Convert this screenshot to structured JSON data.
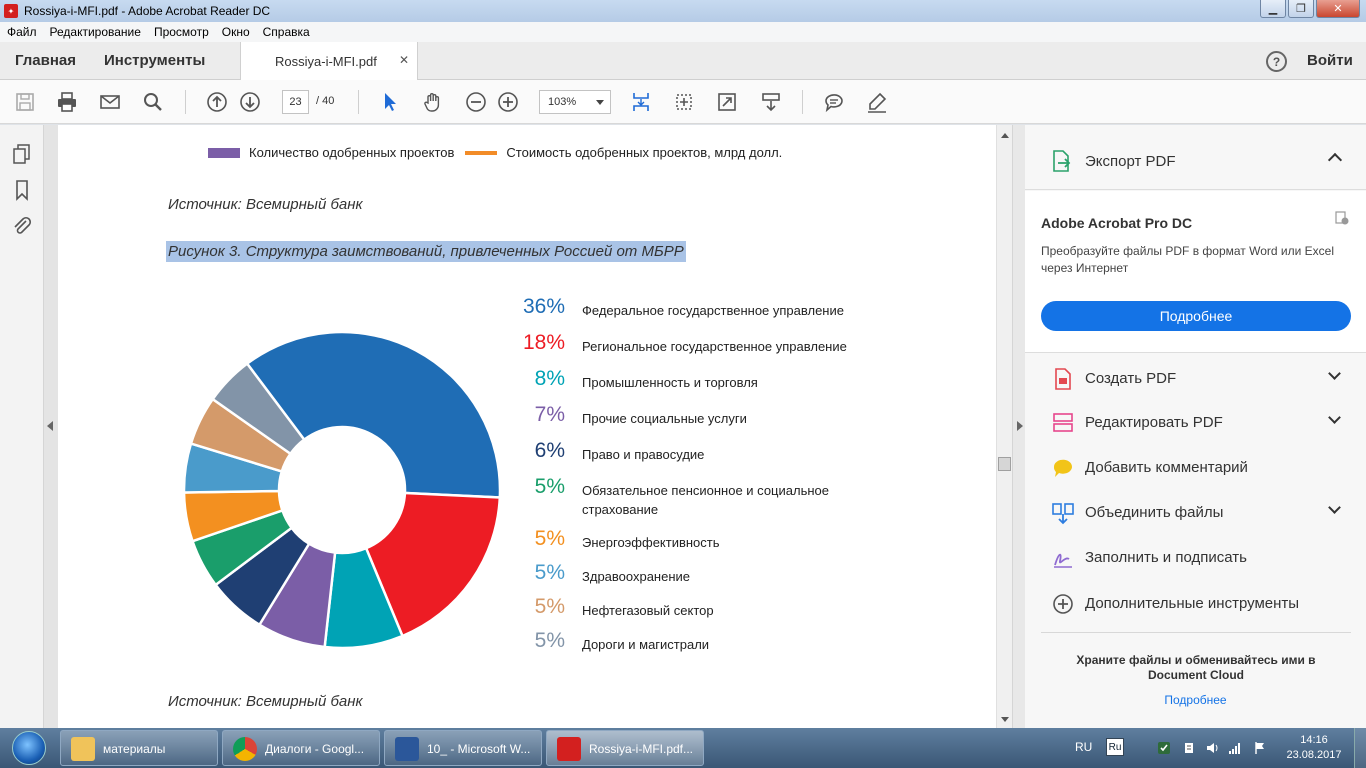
{
  "window": {
    "title": "Rossiya-i-MFI.pdf - Adobe Acrobat Reader DC"
  },
  "menu": [
    "Файл",
    "Редактирование",
    "Просмотр",
    "Окно",
    "Справка"
  ],
  "tabs": {
    "home": "Главная",
    "tools": "Инструменты",
    "document": "Rossiya-i-MFI.pdf",
    "signin": "Войти"
  },
  "toolbar": {
    "page_current": "23",
    "page_total": "/ 40",
    "zoom": "103%"
  },
  "document": {
    "legend": [
      {
        "label": "Количество одобренных проектов",
        "color": "#7b5ea7",
        "type": "box"
      },
      {
        "label": "Стоимость одобренных проектов, млрд долл.",
        "color": "#f28c28",
        "type": "line"
      }
    ],
    "source_1": "Источник: Всемирный банк",
    "figure_title": "Рисунок 3. Структура заимствований, привлеченных Россией от МБРР",
    "source_2": "Источник: Всемирный банк"
  },
  "chart_data": {
    "type": "pie",
    "donut": true,
    "title": "Рисунок 3. Структура заимствований, привлеченных Россией от МБРР",
    "slices": [
      {
        "label": "Федеральное государственное управление",
        "value": 36,
        "pct_label": "36%",
        "color": "#1f6db5"
      },
      {
        "label": "Региональное государственное управление",
        "value": 18,
        "pct_label": "18%",
        "color": "#ed1c24"
      },
      {
        "label": "Промышленность и торговля",
        "value": 8,
        "pct_label": "8%",
        "color": "#00a3b5"
      },
      {
        "label": "Прочие социальные услуги",
        "value": 7,
        "pct_label": "7%",
        "color": "#7b5ea7"
      },
      {
        "label": "Право и правосудие",
        "value": 6,
        "pct_label": "6%",
        "color": "#1f3f73"
      },
      {
        "label": "Обязательное пенсионное и социальное страхование",
        "value": 5,
        "pct_label": "5%",
        "color": "#1a9e6b"
      },
      {
        "label": "Энергоэффективность",
        "value": 5,
        "pct_label": "5%",
        "color": "#f39020"
      },
      {
        "label": "Здравоохранение",
        "value": 5,
        "pct_label": "5%",
        "color": "#4a9bcb"
      },
      {
        "label": "Нефтегазовый сектор",
        "value": 5,
        "pct_label": "5%",
        "color": "#d49a6a"
      },
      {
        "label": "Дороги и магистрали",
        "value": 5,
        "pct_label": "5%",
        "color": "#8294a8"
      }
    ]
  },
  "right_panel": {
    "export": "Экспорт PDF",
    "promo_title": "Adobe Acrobat Pro DC",
    "promo_desc": "Преобразуйте файлы PDF в формат Word или Excel через Интернет",
    "promo_button": "Подробнее",
    "tools": [
      {
        "label": "Создать PDF",
        "icon": "create-pdf-icon",
        "color": "#e34850",
        "caret": true
      },
      {
        "label": "Редактировать PDF",
        "icon": "edit-pdf-icon",
        "color": "#e6468c",
        "caret": true
      },
      {
        "label": "Добавить комментарий",
        "icon": "comment-icon",
        "color": "#f2c418",
        "caret": false
      },
      {
        "label": "Объединить файлы",
        "icon": "combine-files-icon",
        "color": "#2d7de0",
        "caret": true
      },
      {
        "label": "Заполнить и подписать",
        "icon": "fill-sign-icon",
        "color": "#8f6bd1",
        "caret": false
      },
      {
        "label": "Дополнительные инструменты",
        "icon": "more-tools-icon",
        "color": "#555555",
        "caret": false
      }
    ],
    "cloud_text": "Храните файлы и обменивайтесь ими в Document Cloud",
    "cloud_link": "Подробнее"
  },
  "taskbar": {
    "items": [
      {
        "label": "материалы",
        "icon": "folder-icon",
        "color": "#f0c35a"
      },
      {
        "label": "Диалоги - Googl...",
        "icon": "chrome-icon",
        "color": "#4285f4"
      },
      {
        "label": "10_ - Microsoft W...",
        "icon": "word-icon",
        "color": "#2b579a"
      },
      {
        "label": "Rossiya-i-MFI.pdf...",
        "icon": "acrobat-icon",
        "color": "#d3201f"
      }
    ],
    "lang": "RU",
    "lang_badge": "Ru",
    "time": "14:16",
    "date": "23.08.2017"
  }
}
